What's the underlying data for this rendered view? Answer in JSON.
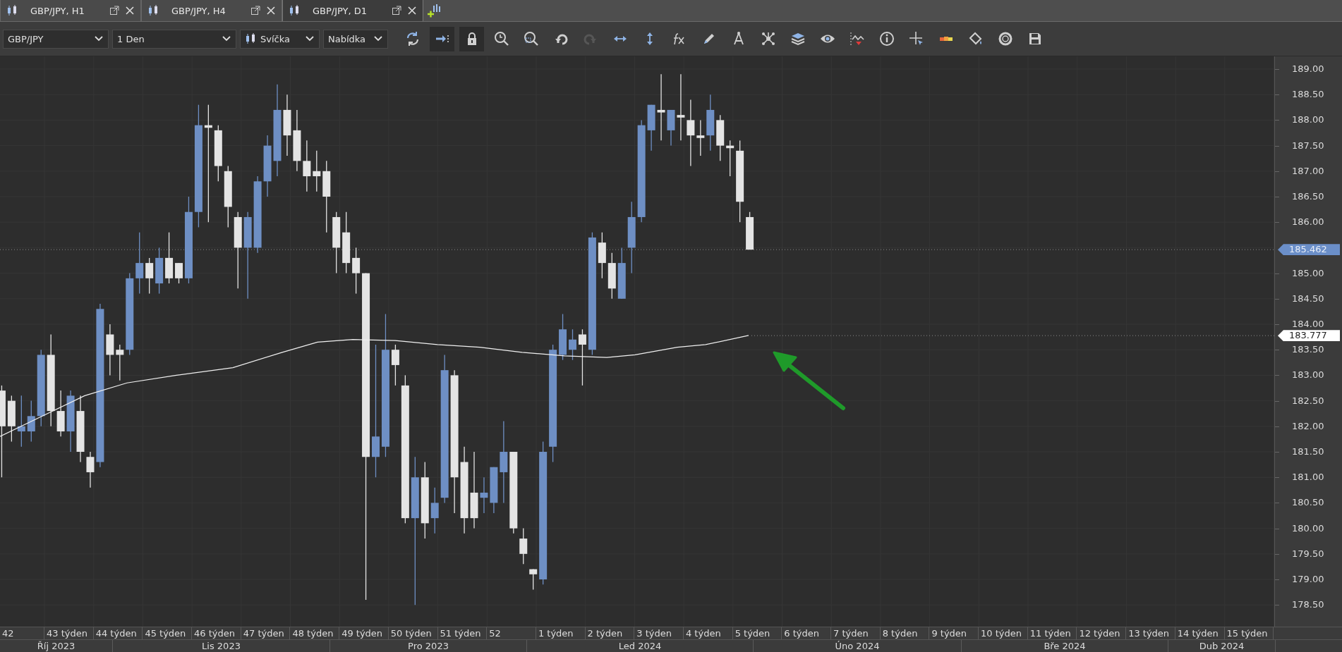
{
  "tabs": [
    {
      "label": "GBP/JPY, H1",
      "selected": false
    },
    {
      "label": "GBP/JPY, H4",
      "selected": false
    },
    {
      "label": "GBP/JPY, D1",
      "selected": true
    }
  ],
  "toolbar": {
    "dropdowns": [
      {
        "kind": "symbol",
        "value": "GBP/JPY"
      },
      {
        "kind": "period",
        "value": "1 Den"
      },
      {
        "kind": "chart-type",
        "value": "Svíčka"
      },
      {
        "kind": "price",
        "value": "Nabídka"
      }
    ],
    "buttons": [
      {
        "active": false,
        "disabled": false
      },
      {
        "active": true,
        "disabled": false
      },
      {
        "active": true,
        "disabled": false
      },
      {
        "active": false,
        "disabled": false
      },
      {
        "active": false,
        "disabled": false
      },
      {
        "active": false,
        "disabled": false
      },
      {
        "active": false,
        "disabled": true
      },
      {
        "active": false,
        "disabled": false
      },
      {
        "active": false,
        "disabled": false
      },
      {
        "active": false,
        "disabled": false
      },
      {
        "active": false,
        "disabled": false
      },
      {
        "active": false,
        "disabled": false
      },
      {
        "active": false,
        "disabled": false
      },
      {
        "active": false,
        "disabled": false
      },
      {
        "active": false,
        "disabled": false
      },
      {
        "active": false,
        "disabled": false
      },
      {
        "active": false,
        "disabled": false
      },
      {
        "active": false,
        "disabled": false
      },
      {
        "active": false,
        "disabled": false
      },
      {
        "active": false,
        "disabled": false
      },
      {
        "active": false,
        "disabled": false
      },
      {
        "active": false,
        "disabled": false
      }
    ]
  },
  "chart": {
    "price_axis": {
      "labels": [
        "189.00",
        "188.50",
        "188.00",
        "187.50",
        "187.00",
        "186.50",
        "186.00",
        "185.00",
        "184.50",
        "184.00",
        "183.50",
        "183.00",
        "182.50",
        "182.00",
        "181.50",
        "181.00",
        "180.50",
        "180.00",
        "179.50",
        "179.00",
        "178.50"
      ],
      "markers": [
        {
          "kind": "last-price",
          "text": "185.462"
        },
        {
          "kind": "indicator",
          "text": "183.777"
        }
      ]
    },
    "weeks": [
      "42",
      "43 týden",
      "44 týden",
      "45 týden",
      "46 týden",
      "47 týden",
      "48 týden",
      "49 týden",
      "50 týden",
      "51 týden",
      "52",
      "1 týden",
      "2 týden",
      "3 týden",
      "4 týden",
      "5 týden",
      "6 týden",
      "7 týden",
      "8 týden",
      "9 týden",
      "10 týden",
      "11 týden",
      "12 týden",
      "13 týden",
      "14 týden",
      "15 týden"
    ],
    "months": [
      "Říj 2023",
      "Lis 2023",
      "Pro 2023",
      "Led 2024",
      "Úno 2024",
      "Bře 2024",
      "Dub 2024"
    ]
  }
}
